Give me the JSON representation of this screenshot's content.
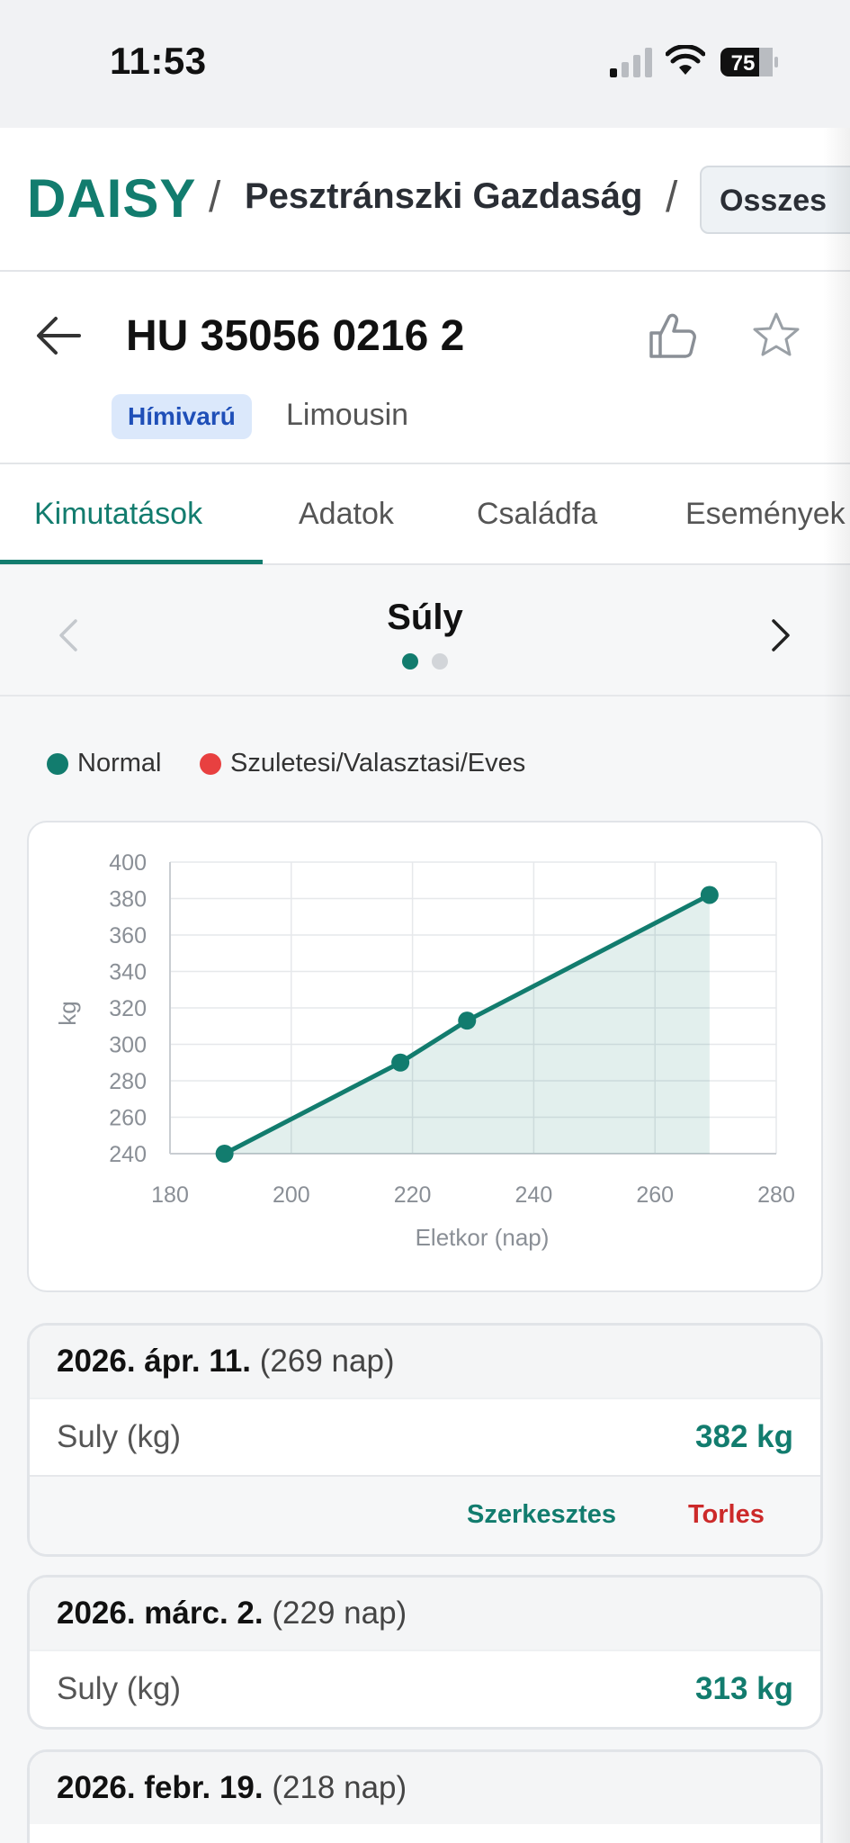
{
  "status_bar": {
    "time": "11:53",
    "battery": "75"
  },
  "header": {
    "logo": "DAISY",
    "separator": "/",
    "farm_name": "Pesztránszki Gazdaság",
    "scope_button": "Osszes"
  },
  "animal": {
    "id": "HU 35056 0216 2",
    "sex_badge": "Hímivarú",
    "breed": "Limousin"
  },
  "tabs": [
    {
      "label": "Kimutatások",
      "active": true
    },
    {
      "label": "Adatok",
      "active": false
    },
    {
      "label": "Családfa",
      "active": false
    },
    {
      "label": "Események",
      "active": false
    }
  ],
  "carousel": {
    "title": "Súly",
    "pages": 2,
    "current_page": 1
  },
  "legend": [
    {
      "label": "Normal",
      "color": "#127c6e"
    },
    {
      "label": "Szuletesi/Valasztasi/Eves",
      "color": "#e84040"
    }
  ],
  "chart_data": {
    "type": "area",
    "xlabel": "Eletkor (nap)",
    "ylabel": "kg",
    "xlim": [
      180,
      280
    ],
    "ylim": [
      240,
      400
    ],
    "x_ticks": [
      180,
      200,
      220,
      240,
      260,
      280
    ],
    "y_ticks": [
      240,
      260,
      280,
      300,
      320,
      340,
      360,
      380,
      400
    ],
    "grid": true,
    "series": [
      {
        "name": "Normal",
        "color": "#127c6e",
        "points": [
          {
            "x": 189,
            "y": 240
          },
          {
            "x": 218,
            "y": 290
          },
          {
            "x": 229,
            "y": 313
          },
          {
            "x": 269,
            "y": 382
          }
        ]
      }
    ]
  },
  "records": [
    {
      "date": "2026. ápr. 11.",
      "days": "(269 nap)",
      "label": "Suly (kg)",
      "value": "382 kg",
      "edit_label": "Szerkesztes",
      "delete_label": "Torles"
    },
    {
      "date": "2026. márc. 2.",
      "days": "(229 nap)",
      "label": "Suly (kg)",
      "value": "313 kg"
    },
    {
      "date": "2026. febr. 19.",
      "days": "(218 nap)"
    }
  ]
}
